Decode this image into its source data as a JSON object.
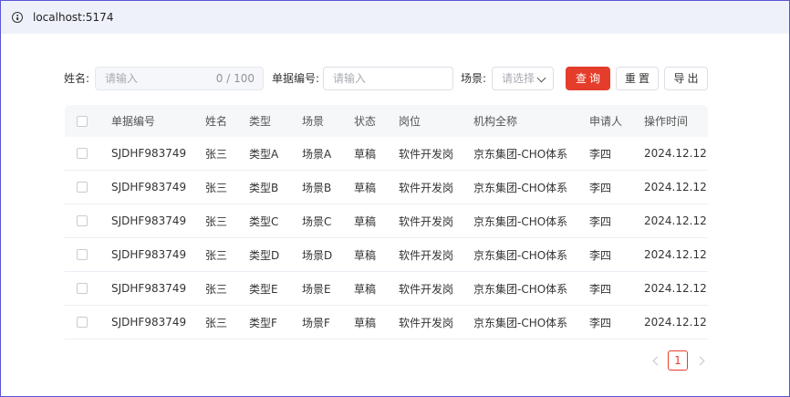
{
  "browser": {
    "url": "localhost:5174"
  },
  "filters": {
    "name_label": "姓名:",
    "name_placeholder": "请输入",
    "name_count": "0 / 100",
    "doc_label": "单据编号:",
    "doc_placeholder": "请输入",
    "scene_label": "场景:",
    "scene_placeholder": "请选择",
    "query_button": "查询",
    "reset_button": "重置",
    "export_button": "导出"
  },
  "table": {
    "columns": [
      "单据编号",
      "姓名",
      "类型",
      "场景",
      "状态",
      "岗位",
      "机构全称",
      "申请人",
      "操作时间"
    ],
    "rows": [
      [
        "SJDHF983749",
        "张三",
        "类型A",
        "场景A",
        "草稿",
        "软件开发岗",
        "京东集团-CHO体系",
        "李四",
        "2024.12.12"
      ],
      [
        "SJDHF983749",
        "张三",
        "类型B",
        "场景B",
        "草稿",
        "软件开发岗",
        "京东集团-CHO体系",
        "李四",
        "2024.12.12"
      ],
      [
        "SJDHF983749",
        "张三",
        "类型C",
        "场景C",
        "草稿",
        "软件开发岗",
        "京东集团-CHO体系",
        "李四",
        "2024.12.12"
      ],
      [
        "SJDHF983749",
        "张三",
        "类型D",
        "场景D",
        "草稿",
        "软件开发岗",
        "京东集团-CHO体系",
        "李四",
        "2024.12.12"
      ],
      [
        "SJDHF983749",
        "张三",
        "类型E",
        "场景E",
        "草稿",
        "软件开发岗",
        "京东集团-CHO体系",
        "李四",
        "2024.12.12"
      ],
      [
        "SJDHF983749",
        "张三",
        "类型F",
        "场景F",
        "草稿",
        "软件开发岗",
        "京东集团-CHO体系",
        "李四",
        "2024.12.12"
      ]
    ]
  },
  "pagination": {
    "current_page": "1"
  },
  "colors": {
    "accent": "#e53d2b",
    "header_bg": "#f6f7f9",
    "url_bar_bg": "#eef1fa"
  }
}
